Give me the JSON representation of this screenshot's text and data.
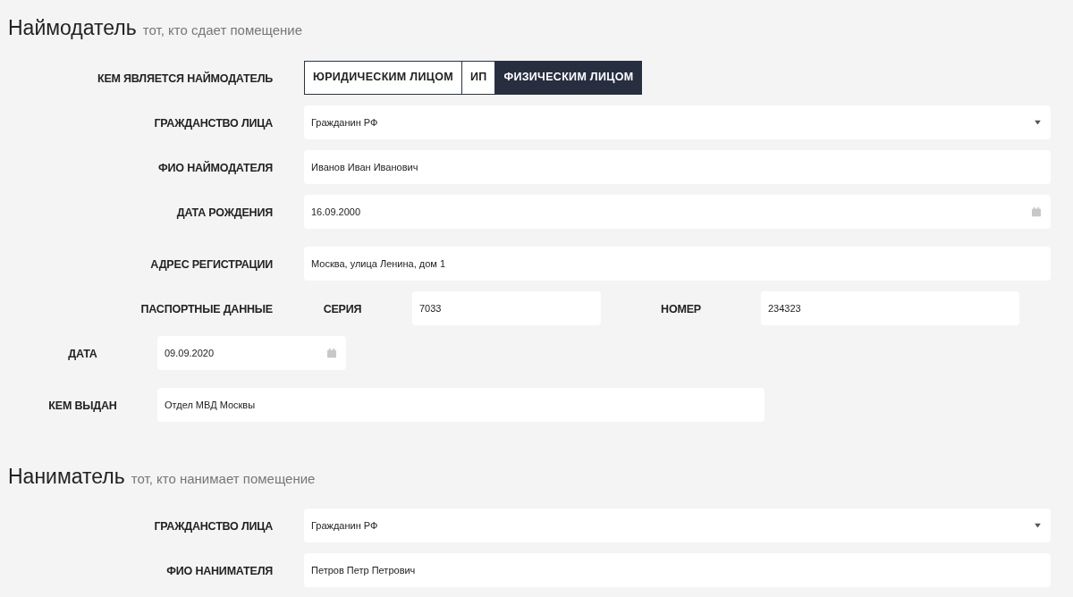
{
  "sections": [
    {
      "title": "Наймодатель",
      "subtitle": "тот, кто сдает помещение",
      "rows": [
        {
          "kind": "toggle",
          "label": "КЕМ ЯВЛЯЕТСЯ НАЙМОДАТЕЛЬ",
          "options": [
            {
              "label": "ЮРИДИЧЕСКИМ ЛИЦОМ",
              "selected": false
            },
            {
              "label": "ИП",
              "selected": false
            },
            {
              "label": "ФИЗИЧЕСКИМ ЛИЦОМ",
              "selected": true
            }
          ]
        },
        {
          "kind": "select",
          "label": "ГРАЖДАНСТВО ЛИЦА",
          "value": "Гражданин РФ"
        },
        {
          "kind": "text",
          "label": "ФИО НАЙМОДАТЕЛЯ",
          "value": "Иванов Иван Иванович"
        },
        {
          "kind": "date",
          "label": "ДАТА РОЖДЕНИЯ",
          "value": "16.09.2000"
        },
        {
          "kind": "text",
          "label": "АДРЕС РЕГИСТРАЦИИ",
          "value": "Москва, улица Ленина, дом 1"
        },
        {
          "kind": "passport",
          "label": "ПАСПОРТНЫЕ ДАННЫЕ",
          "series_label": "СЕРИЯ",
          "series": "7033",
          "number_label": "НОМЕР",
          "number": "234323"
        },
        {
          "kind": "short_date",
          "label": "ДАТА",
          "value": "09.09.2020"
        },
        {
          "kind": "short_text",
          "label": "КЕМ ВЫДАН",
          "value": "Отдел МВД Москвы"
        }
      ]
    },
    {
      "title": "Наниматель",
      "subtitle": "тот, кто нанимает помещение",
      "rows": [
        {
          "kind": "select",
          "label": "ГРАЖДАНСТВО ЛИЦА",
          "value": "Гражданин РФ"
        },
        {
          "kind": "text",
          "label": "ФИО НАНИМАТЕЛЯ",
          "value": "Петров Петр Петрович"
        }
      ]
    }
  ]
}
